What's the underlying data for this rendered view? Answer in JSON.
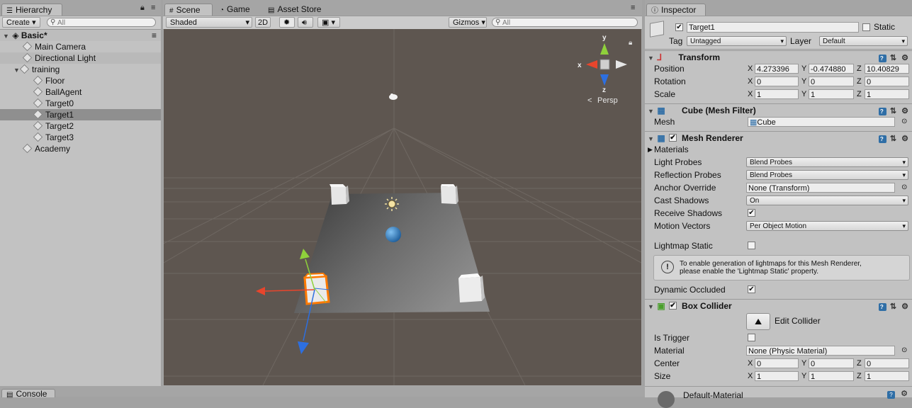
{
  "hierarchy": {
    "tab_label": "Hierarchy",
    "create_label": "Create",
    "search_placeholder": "All",
    "scene_name": "Basic*",
    "items": [
      {
        "label": "Main Camera"
      },
      {
        "label": "Directional Light"
      },
      {
        "label": "training"
      },
      {
        "label": "Floor"
      },
      {
        "label": "BallAgent"
      },
      {
        "label": "Target0"
      },
      {
        "label": "Target1"
      },
      {
        "label": "Target2"
      },
      {
        "label": "Target3"
      },
      {
        "label": "Academy"
      }
    ]
  },
  "scene_view": {
    "tabs": [
      {
        "label": "Scene"
      },
      {
        "label": "Game"
      },
      {
        "label": "Asset Store"
      }
    ],
    "shading_mode": "Shaded",
    "mode_2d": "2D",
    "gizmos_label": "Gizmos",
    "search_placeholder": "All",
    "gizmo_axes": {
      "x": "x",
      "y": "y",
      "z": "z",
      "persp": "Persp"
    }
  },
  "inspector": {
    "tab_label": "Inspector",
    "object_name": "Target1",
    "static_label": "Static",
    "tag_label": "Tag",
    "tag_value": "Untagged",
    "layer_label": "Layer",
    "layer_value": "Default",
    "transform": {
      "title": "Transform",
      "position_label": "Position",
      "rotation_label": "Rotation",
      "scale_label": "Scale",
      "position": {
        "x": "4.273396",
        "y": "-0.474880",
        "z": "10.40829"
      },
      "rotation": {
        "x": "0",
        "y": "0",
        "z": "0"
      },
      "scale": {
        "x": "1",
        "y": "1",
        "z": "1"
      }
    },
    "mesh_filter": {
      "title": "Cube (Mesh Filter)",
      "mesh_label": "Mesh",
      "mesh_value": "Cube"
    },
    "mesh_renderer": {
      "title": "Mesh Renderer",
      "materials_label": "Materials",
      "light_probes_label": "Light Probes",
      "light_probes_value": "Blend Probes",
      "reflection_probes_label": "Reflection Probes",
      "reflection_probes_value": "Blend Probes",
      "anchor_override_label": "Anchor Override",
      "anchor_override_value": "None (Transform)",
      "cast_shadows_label": "Cast Shadows",
      "cast_shadows_value": "On",
      "receive_shadows_label": "Receive Shadows",
      "motion_vectors_label": "Motion Vectors",
      "motion_vectors_value": "Per Object Motion",
      "lightmap_static_label": "Lightmap Static",
      "info_text_1": "To enable generation of lightmaps for this Mesh Renderer,",
      "info_text_2": "please enable the 'Lightmap Static' property.",
      "dynamic_occluded_label": "Dynamic Occluded"
    },
    "box_collider": {
      "title": "Box Collider",
      "edit_collider_label": "Edit Collider",
      "is_trigger_label": "Is Trigger",
      "material_label": "Material",
      "material_value": "None (Physic Material)",
      "center_label": "Center",
      "size_label": "Size",
      "center": {
        "x": "0",
        "y": "0",
        "z": "0"
      },
      "size": {
        "x": "1",
        "y": "1",
        "z": "1"
      }
    },
    "default_material_label": "Default-Material",
    "axis_x": "X",
    "axis_y": "Y",
    "axis_z": "Z"
  },
  "console": {
    "tab_label": "Console"
  },
  "colors": {
    "selection_orange": "#ff7a00",
    "gizmo_x": "#e8452c",
    "gizmo_y": "#8fd13b",
    "gizmo_z": "#2d6fe0"
  }
}
